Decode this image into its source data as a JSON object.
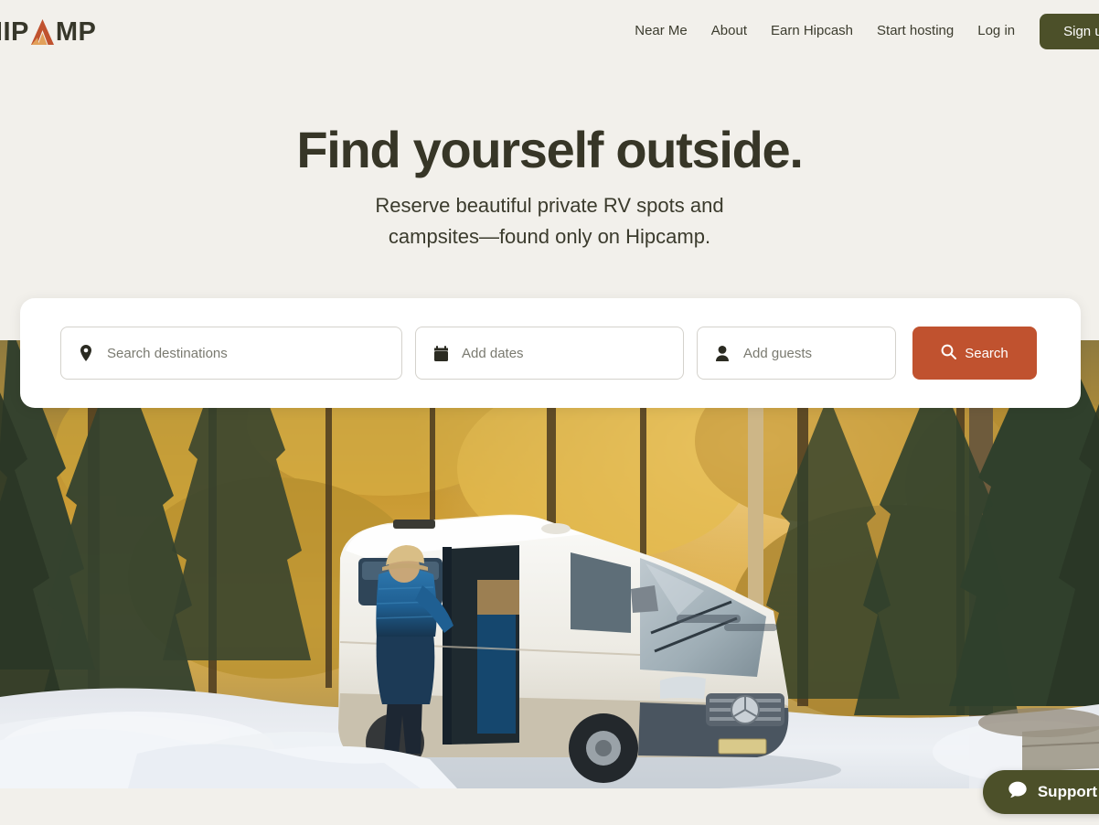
{
  "brand": {
    "logo_text_before": "HIP",
    "logo_tent_letter": "A",
    "logo_text_after": "MP",
    "logo_name": "HIPCAMP",
    "tent_color": "#C0522F",
    "wordmark_color": "#37372A"
  },
  "header": {
    "nav": [
      {
        "label": "Near Me",
        "name": "near-me"
      },
      {
        "label": "About",
        "name": "about"
      },
      {
        "label": "Earn Hipcash",
        "name": "earn-hipcash"
      },
      {
        "label": "Start hosting",
        "name": "start-hosting"
      },
      {
        "label": "Log in",
        "name": "log-in"
      }
    ],
    "signup_label": "Sign up",
    "signup_color": "#4C5029"
  },
  "hero": {
    "headline": "Find yourself outside.",
    "subheadline": "Reserve beautiful private RV spots and campsites—found only on Hipcamp.",
    "image_description": "White camper van parked in a snowy forest at sunset with a person in a blue jacket standing at the open sliding door"
  },
  "search": {
    "destination_placeholder": "Search destinations",
    "destination_value": "",
    "destination_icon": "location-pin-icon",
    "dates_placeholder": "Add dates",
    "dates_value": "",
    "dates_icon": "calendar-icon",
    "guests_placeholder": "Add guests",
    "guests_value": "",
    "guests_icon": "person-icon",
    "search_button_label": "Search",
    "search_button_icon": "magnifier-icon",
    "search_button_color": "#C0522F"
  },
  "support": {
    "label": "Support",
    "icon": "chat-bubble-icon",
    "color": "#4C5029"
  },
  "page": {
    "background_color": "#F2F0EB",
    "text_color": "#373627"
  }
}
